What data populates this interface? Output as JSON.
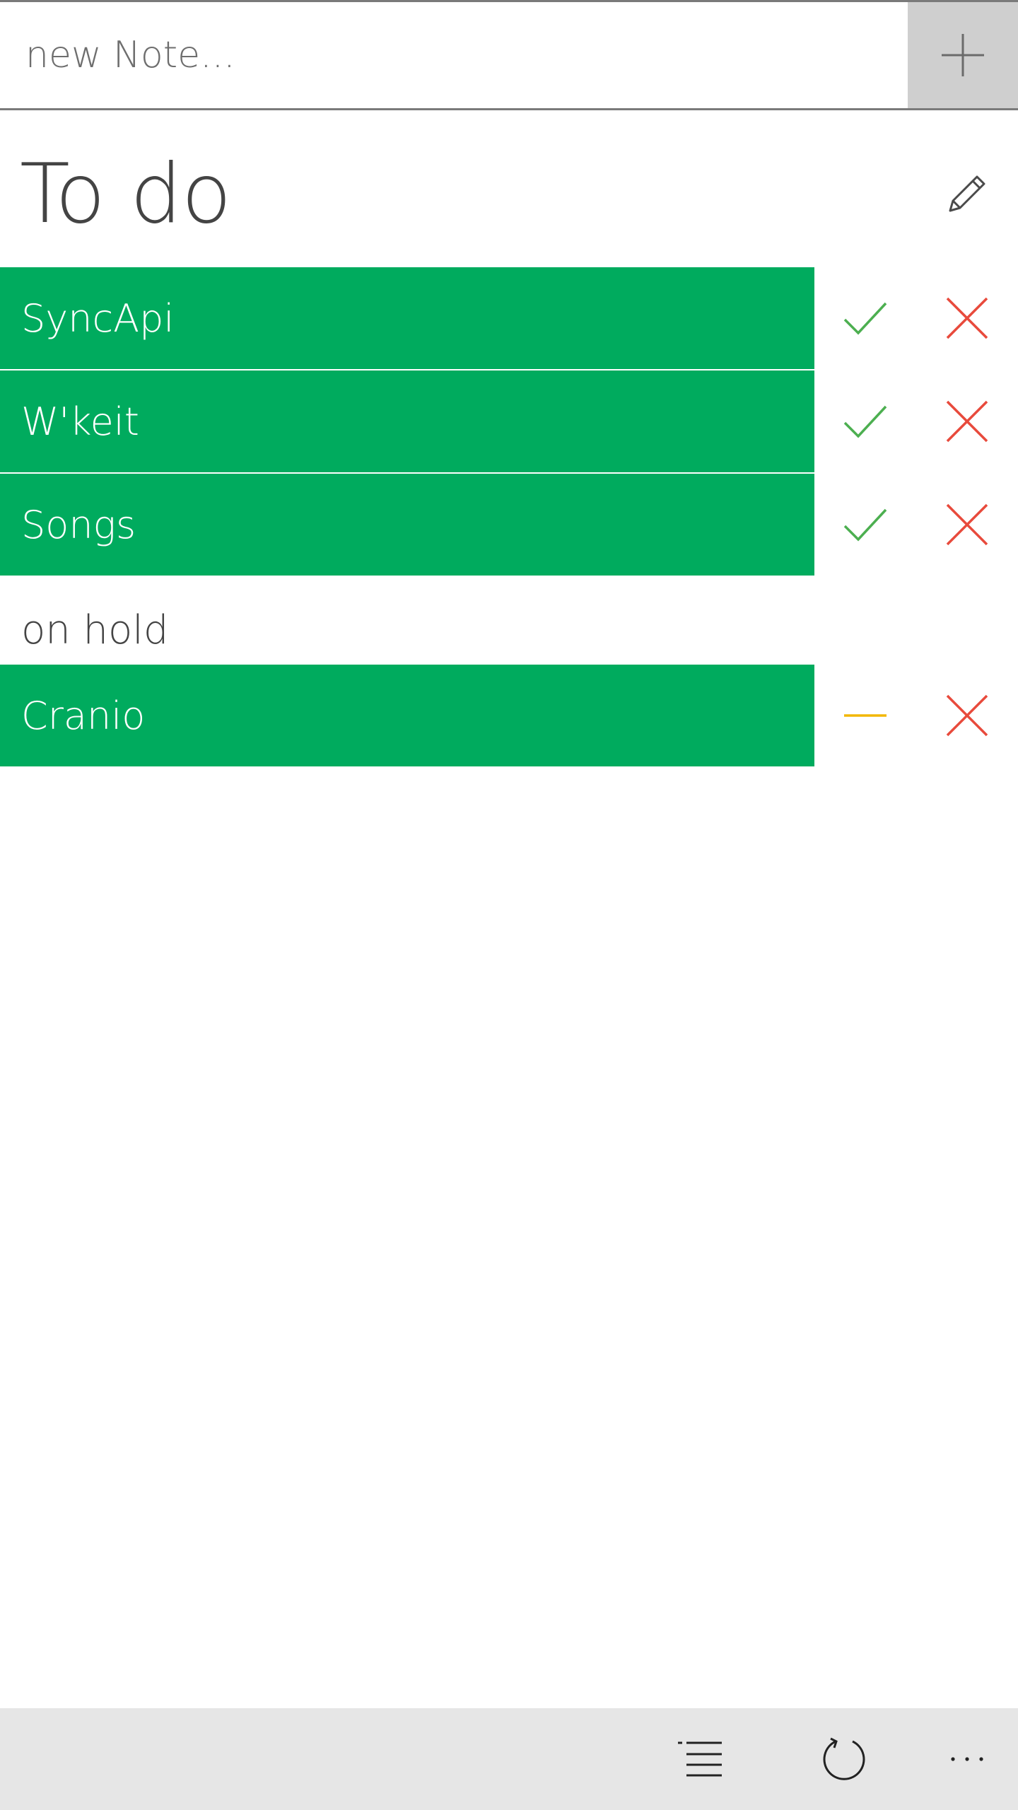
{
  "new_note": {
    "placeholder": "new Note..."
  },
  "page": {
    "title": "To do"
  },
  "todo_items": [
    {
      "label": "SyncApi",
      "status": "active"
    },
    {
      "label": "W'keit",
      "status": "active"
    },
    {
      "label": "Songs",
      "status": "active"
    }
  ],
  "on_hold": {
    "header": "on hold",
    "items": [
      {
        "label": "Cranio",
        "status": "on-hold"
      }
    ]
  },
  "icons": {
    "add": "plus-icon",
    "edit": "pencil-icon",
    "done": "checkmark-icon",
    "hold": "minus-icon",
    "remove": "close-icon",
    "list": "list-icon",
    "refresh": "refresh-icon",
    "more": "ellipsis-icon"
  },
  "colors": {
    "tile": "#00ab5e",
    "check": "#4caf50",
    "remove": "#e84a3c",
    "hold": "#f2b705",
    "app_bar": "#e6e6e6",
    "add_button": "#cfcfcf"
  }
}
